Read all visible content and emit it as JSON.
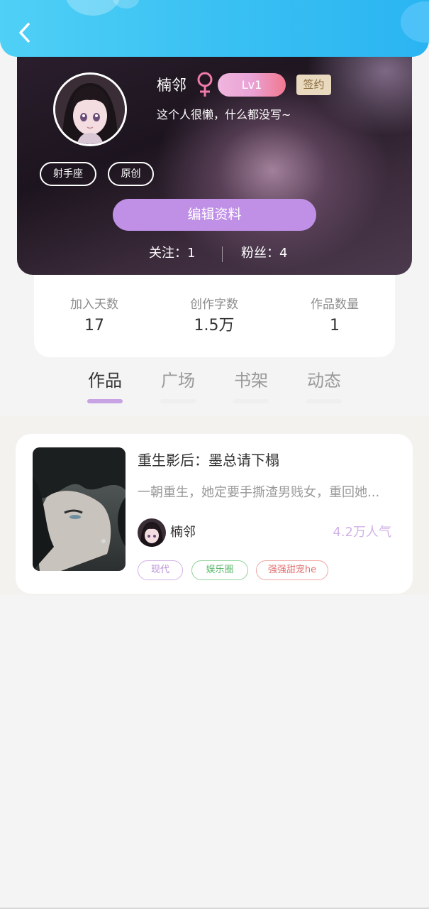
{
  "topbar": {
    "back_icon": "chevron-left-icon"
  },
  "profile": {
    "name": "楠邻",
    "gender_icon": "female-symbol-icon",
    "level": "Lv1",
    "sign_badge": "签约",
    "bio": "这个人很懒，什么都没写~",
    "tags": [
      "射手座",
      "原创"
    ],
    "edit_button": "编辑资料",
    "follow_label": "关注：1",
    "fans_label": "粉丝：4"
  },
  "stats": [
    {
      "label": "加入天数",
      "value": "17"
    },
    {
      "label": "创作字数",
      "value": "1.5万"
    },
    {
      "label": "作品数量",
      "value": "1"
    }
  ],
  "tabs": [
    {
      "label": "作品",
      "active": true
    },
    {
      "label": "广场",
      "active": false
    },
    {
      "label": "书架",
      "active": false
    },
    {
      "label": "动态",
      "active": false
    }
  ],
  "works": [
    {
      "title": "重生影后：墨总请下榻",
      "description": "一朝重生，她定要手撕渣男贱女，重回她...",
      "author": "楠邻",
      "popularity": "4.2万人气",
      "tags": [
        "现代",
        "娱乐圈",
        "强强甜宠he"
      ]
    }
  ],
  "colors": {
    "topbar": "#3cc2f3",
    "accent_purple": "#bf90e6",
    "level_badge": "#e9a2d6",
    "sign_badge": "#e8d9bf"
  }
}
